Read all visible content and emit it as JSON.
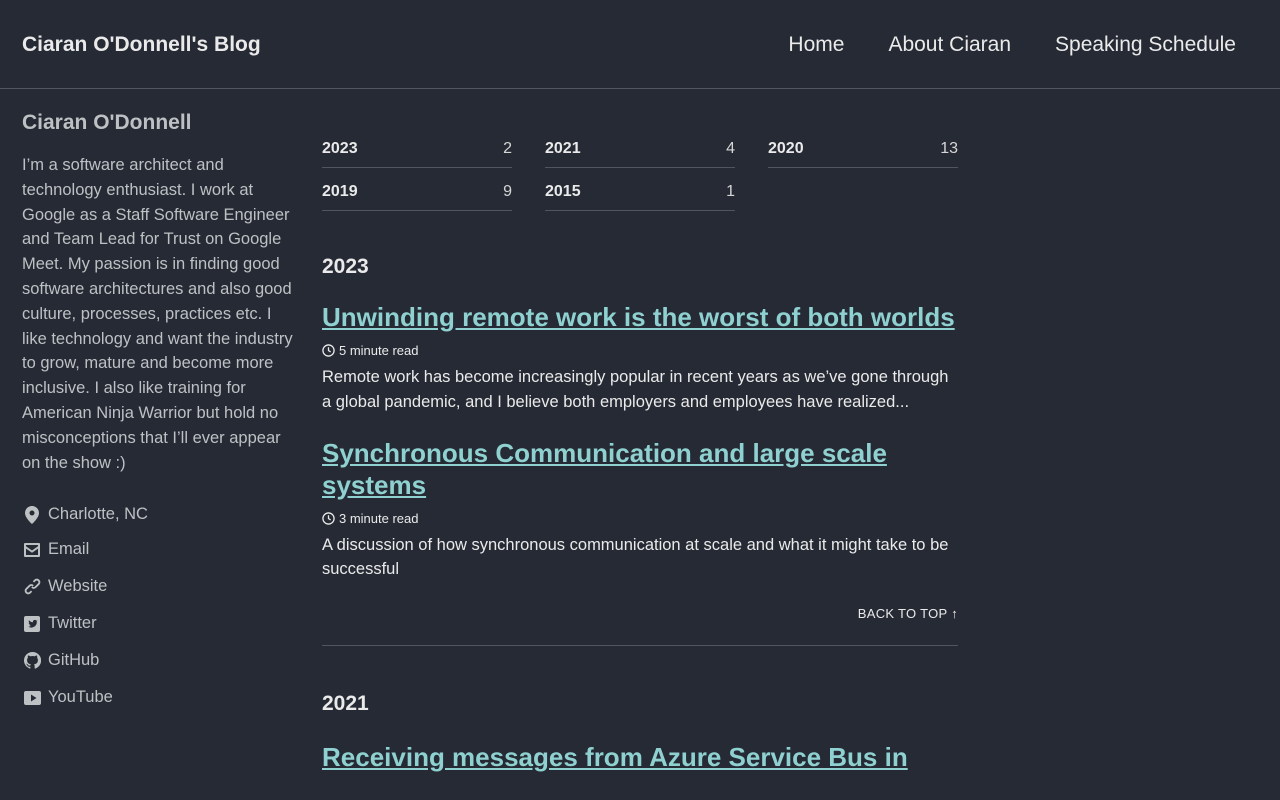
{
  "masthead": {
    "site_title": "Ciaran O'Donnell's Blog",
    "nav": [
      "Home",
      "About Ciaran",
      "Speaking Schedule"
    ]
  },
  "sidebar": {
    "name": "Ciaran O'Donnell",
    "bio": "I’m a software architect and technology enthusiast. I work at Google as a Staff Software Engineer and Team Lead for Trust on Google Meet. My passion is in finding good software architectures and also good culture, processes, practices etc. I like technology and want the industry to grow, mature and become more inclusive. I also like training for American Ninja Warrior but hold no misconceptions that I’ll ever appear on the show :)",
    "links": [
      {
        "label": "Charlotte, NC",
        "icon": "map-marker-icon"
      },
      {
        "label": "Email",
        "icon": "envelope-icon"
      },
      {
        "label": "Website",
        "icon": "link-icon"
      },
      {
        "label": "Twitter",
        "icon": "twitter-icon"
      },
      {
        "label": "GitHub",
        "icon": "github-icon"
      },
      {
        "label": "YouTube",
        "icon": "youtube-icon"
      }
    ]
  },
  "archive": {
    "years": [
      {
        "year": "2023",
        "count": "2"
      },
      {
        "year": "2021",
        "count": "4"
      },
      {
        "year": "2020",
        "count": "13"
      },
      {
        "year": "2019",
        "count": "9"
      },
      {
        "year": "2015",
        "count": "1"
      }
    ]
  },
  "sections": {
    "y2023": {
      "heading": "2023",
      "posts": [
        {
          "title": "Unwinding remote work is the worst of both worlds",
          "read_time": "5 minute read",
          "excerpt": "Remote work has become increasingly popular in recent years as we’ve gone through a global pandemic, and I believe both employers and employees have realized..."
        },
        {
          "title": "Synchronous Communication and large scale systems",
          "read_time": "3 minute read",
          "excerpt": "A discussion of how synchronous communication at scale and what it might take to be successful"
        }
      ],
      "back_to_top": "BACK TO TOP ↑"
    },
    "y2021": {
      "heading": "2021",
      "posts": [
        {
          "title": "Receiving messages from Azure Service Bus in"
        }
      ]
    }
  },
  "colors": {
    "background": "#252a34",
    "link": "#8fd1d0",
    "text": "#eaeaea",
    "muted": "#bdc1c4"
  }
}
